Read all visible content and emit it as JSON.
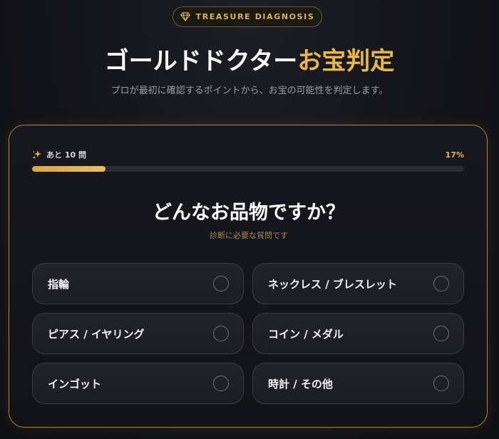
{
  "badge": {
    "icon": "diamond-icon",
    "text": "TREASURE DIAGNOSIS",
    "color": "#d9b35a"
  },
  "header": {
    "title_main": "ゴールドドクター",
    "title_accent": "お宝判定",
    "subtitle": "プロが最初に確認するポイントから、お宝の可能性を判定します。"
  },
  "progress": {
    "icon": "sparkle-icon",
    "label": "あと 10 問",
    "percent_text": "17%",
    "value": 0.17
  },
  "question": {
    "title": "どんなお品物ですか？",
    "subtitle": "診断に必要な質問です"
  },
  "options": [
    {
      "label": "指輪"
    },
    {
      "label": "ネックレス / ブレスレット"
    },
    {
      "label": "ピアス / イヤリング"
    },
    {
      "label": "コイン / メダル"
    },
    {
      "label": "インゴット"
    },
    {
      "label": "時計 / その他"
    }
  ],
  "colors": {
    "accent": "#e8b64a",
    "background": "#121318",
    "card_border": "#a8893f"
  }
}
